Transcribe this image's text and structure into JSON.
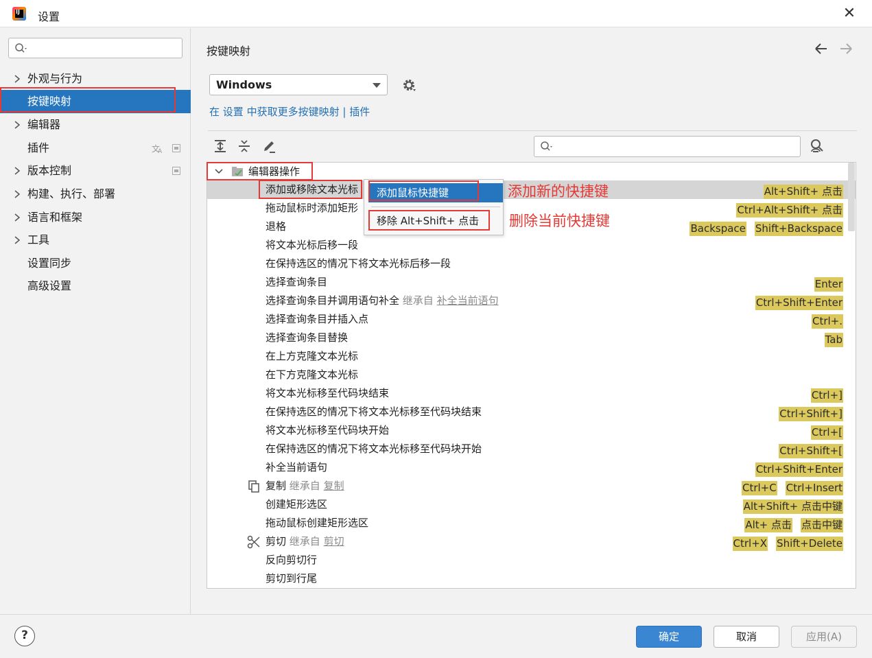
{
  "window": {
    "title": "设置"
  },
  "sidebar": {
    "search_placeholder": "",
    "items": [
      {
        "label": "外观与行为",
        "expandable": true
      },
      {
        "label": "按键映射",
        "expandable": false,
        "selected": true
      },
      {
        "label": "编辑器",
        "expandable": true
      },
      {
        "label": "插件",
        "expandable": false,
        "icons": [
          "translate-icon",
          "module-icon"
        ]
      },
      {
        "label": "版本控制",
        "expandable": true,
        "icons": [
          "module-icon"
        ]
      },
      {
        "label": "构建、执行、部署",
        "expandable": true
      },
      {
        "label": "语言和框架",
        "expandable": true
      },
      {
        "label": "工具",
        "expandable": true
      },
      {
        "label": "设置同步",
        "expandable": false
      },
      {
        "label": "高级设置",
        "expandable": false
      }
    ]
  },
  "content": {
    "title": "按键映射",
    "keymap": {
      "selected": "Windows"
    },
    "link": {
      "prefix": "在",
      "settings_link": "设置",
      "middle": "中获取更多按键映射",
      "sep": "|",
      "plugins_link": "插件"
    },
    "filter_placeholder": ""
  },
  "tree": {
    "group": {
      "label": "编辑器操作"
    },
    "rows": [
      {
        "label": "添加或移除文本光标",
        "shortcuts": [
          "Alt+Shift+ 点击"
        ],
        "highlighted": true
      },
      {
        "label": "拖动鼠标时添加矩形",
        "shortcuts": [
          "Ctrl+Alt+Shift+ 点击"
        ]
      },
      {
        "label": "退格",
        "shortcuts": [
          "Backspace",
          "Shift+Backspace"
        ]
      },
      {
        "label": "将文本光标后移一段",
        "shortcuts": []
      },
      {
        "label": "在保持选区的情况下将文本光标后移一段",
        "shortcuts": []
      },
      {
        "label": "选择查询条目",
        "shortcuts": [
          "Enter"
        ]
      },
      {
        "label": "选择查询条目并调用语句补全",
        "inherit": "继承自",
        "inherit_link": "补全当前语句",
        "shortcuts": [
          "Ctrl+Shift+Enter"
        ]
      },
      {
        "label": "选择查询条目并插入点",
        "shortcuts": [
          "Ctrl+."
        ]
      },
      {
        "label": "选择查询条目替换",
        "shortcuts": [
          "Tab"
        ]
      },
      {
        "label": "在上方克隆文本光标",
        "shortcuts": []
      },
      {
        "label": "在下方克隆文本光标",
        "shortcuts": []
      },
      {
        "label": "将文本光标移至代码块结束",
        "shortcuts": [
          "Ctrl+]"
        ]
      },
      {
        "label": "在保持选区的情况下将文本光标移至代码块结束",
        "shortcuts": [
          "Ctrl+Shift+]"
        ]
      },
      {
        "label": "将文本光标移至代码块开始",
        "shortcuts": [
          "Ctrl+["
        ]
      },
      {
        "label": "在保持选区的情况下将文本光标移至代码块开始",
        "shortcuts": [
          "Ctrl+Shift+["
        ]
      },
      {
        "label": "补全当前语句",
        "shortcuts": [
          "Ctrl+Shift+Enter"
        ]
      },
      {
        "label": "复制",
        "icon": "copy-icon",
        "inherit": "继承自",
        "inherit_link": "复制",
        "shortcuts": [
          "Ctrl+C",
          "Ctrl+Insert"
        ]
      },
      {
        "label": "创建矩形选区",
        "shortcuts": [
          "Alt+Shift+ 点击中键"
        ]
      },
      {
        "label": "拖动鼠标创建矩形选区",
        "shortcuts": [
          "Alt+ 点击",
          "点击中键"
        ]
      },
      {
        "label": "剪切",
        "icon": "scissors-icon",
        "inherit": "继承自",
        "inherit_link": "剪切",
        "shortcuts": [
          "Ctrl+X",
          "Shift+Delete"
        ]
      },
      {
        "label": "反向剪切行",
        "shortcuts": []
      },
      {
        "label": "剪切到行尾",
        "shortcuts": []
      }
    ]
  },
  "context_menu": {
    "items": [
      {
        "label": "添加鼠标快捷键",
        "active": true
      },
      {
        "label": "移除 Alt+Shift+ 点击",
        "active": false
      }
    ]
  },
  "annotations": {
    "add_note": "添加新的快捷键",
    "remove_note": "删除当前快捷键"
  },
  "footer": {
    "help": "?",
    "ok": "确定",
    "cancel": "取消",
    "apply": "应用(A)"
  },
  "colors": {
    "accent": "#2675bf",
    "shortcut_bg": "#dcc95d",
    "annotation_red": "#e53935",
    "link": "#2470b3"
  }
}
